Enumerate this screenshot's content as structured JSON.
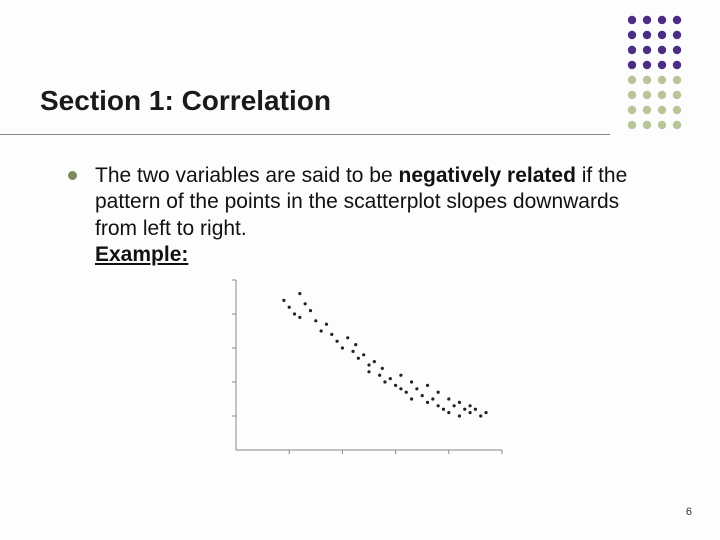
{
  "heading": "Section 1: Correlation",
  "body": {
    "pre": "The two variables are said to be ",
    "bold1": "negatively related",
    "mid": " if the pattern of the points in the scatterplot slopes downwards from left to right.",
    "example_label": "Example:"
  },
  "page_number": "6",
  "deco_colors": {
    "top_rows": "#4b2e83",
    "bottom_rows": "#b8c49a"
  },
  "chart_data": {
    "type": "scatter",
    "title": "",
    "xlabel": "",
    "ylabel": "",
    "xlim": [
      0,
      100
    ],
    "ylim": [
      0,
      100
    ],
    "points": [
      [
        18,
        88
      ],
      [
        20,
        84
      ],
      [
        22,
        80
      ],
      [
        24,
        92
      ],
      [
        24,
        78
      ],
      [
        26,
        86
      ],
      [
        28,
        82
      ],
      [
        30,
        76
      ],
      [
        32,
        70
      ],
      [
        34,
        74
      ],
      [
        36,
        68
      ],
      [
        38,
        64
      ],
      [
        40,
        60
      ],
      [
        42,
        66
      ],
      [
        44,
        58
      ],
      [
        45,
        62
      ],
      [
        46,
        54
      ],
      [
        48,
        56
      ],
      [
        50,
        50
      ],
      [
        50,
        46
      ],
      [
        52,
        52
      ],
      [
        54,
        44
      ],
      [
        55,
        48
      ],
      [
        56,
        40
      ],
      [
        58,
        42
      ],
      [
        60,
        38
      ],
      [
        62,
        44
      ],
      [
        62,
        36
      ],
      [
        64,
        34
      ],
      [
        66,
        40
      ],
      [
        66,
        30
      ],
      [
        68,
        36
      ],
      [
        70,
        32
      ],
      [
        72,
        28
      ],
      [
        72,
        38
      ],
      [
        74,
        30
      ],
      [
        76,
        26
      ],
      [
        76,
        34
      ],
      [
        78,
        24
      ],
      [
        80,
        30
      ],
      [
        80,
        22
      ],
      [
        82,
        26
      ],
      [
        84,
        28
      ],
      [
        84,
        20
      ],
      [
        86,
        24
      ],
      [
        88,
        26
      ],
      [
        88,
        22
      ],
      [
        90,
        24
      ],
      [
        92,
        20
      ],
      [
        94,
        22
      ]
    ]
  }
}
